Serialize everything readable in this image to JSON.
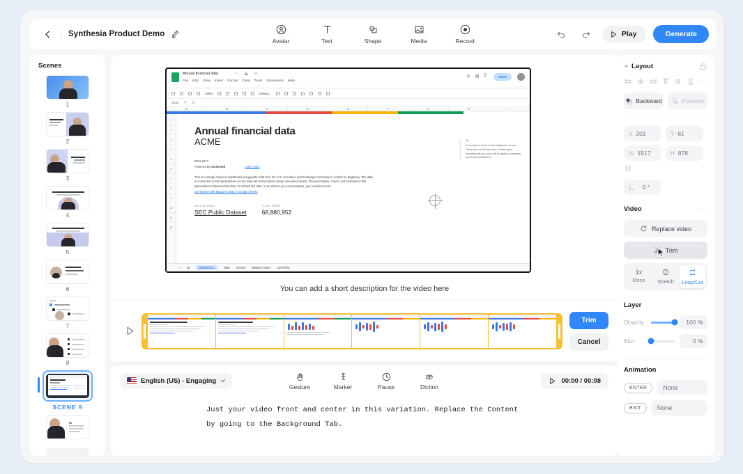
{
  "header": {
    "back_icon": "chevron-left-icon",
    "title": "Synthesia Product Demo",
    "edit_icon": "pencil-icon",
    "tools": [
      {
        "icon": "avatar-icon",
        "label": "Avatar"
      },
      {
        "icon": "text-icon",
        "label": "Text"
      },
      {
        "icon": "shape-icon",
        "label": "Shape"
      },
      {
        "icon": "media-icon",
        "label": "Media"
      },
      {
        "icon": "record-icon",
        "label": "Record"
      }
    ],
    "undo_icon": "undo-icon",
    "redo_icon": "redo-icon",
    "play_label": "Play",
    "generate_label": "Generate",
    "generate_color": "#2f87f8"
  },
  "scenes": {
    "title": "Scenes",
    "items": [
      {
        "number": "1",
        "selected": false
      },
      {
        "number": "2",
        "selected": false
      },
      {
        "number": "3",
        "selected": false
      },
      {
        "number": "4",
        "selected": false
      },
      {
        "number": "5",
        "selected": false
      },
      {
        "number": "6",
        "selected": false
      },
      {
        "number": "7",
        "selected": false
      },
      {
        "number": "8",
        "selected": false
      },
      {
        "number": "SCENE 9",
        "selected": true
      },
      {
        "number": "",
        "selected": false
      }
    ],
    "add_label": "+"
  },
  "canvas": {
    "caption": "You can add a short description for the video here",
    "sheet": {
      "doc_name": "Annual financial data",
      "menus": [
        "File",
        "Edit",
        "View",
        "Insert",
        "Format",
        "Data",
        "Tools",
        "Extensions",
        "Help"
      ],
      "zoom": "100%",
      "font": "Defaul...",
      "cell_ref": "Q1W",
      "share_label": "Share",
      "columns": [
        "A",
        "B",
        "C",
        "D",
        "E",
        "F",
        "G",
        "H",
        "I"
      ],
      "rows": [
        "1",
        "2",
        "3",
        "4",
        "5",
        "6",
        "7",
        "8",
        "9",
        "10",
        "11",
        "12"
      ],
      "title": "Annual financial data",
      "subtitle": "ACME",
      "years": "2013-2017",
      "powered_prefix": "Powered by ",
      "powered_bold": "connected",
      "learn_more": "Learn more",
      "paragraph": "This is a sample financial dashboard using public data from the U.S. Securities and Exchange Commission, hosted on BigQuery. The data is connected to this spreadsheet via the Data tab at the bottom using connected sheets. The pivot tables, charts, and functions in this spreadsheet reference that data. To refresh the data, or to perform your own analysis, you need access to",
      "bigquery_link": "Get started with BigQuery data in Google Sheets",
      "kpis": [
        {
          "label": "DATA SOURCE",
          "value": "SEC Public Dataset",
          "underline": true
        },
        {
          "label": "TOTAL ROWS",
          "value": "68,980,952",
          "underline": false
        }
      ],
      "tip_title": "Tip",
      "tip_body": "To change the theme for this dashboard, choose Theme from the Format menu. Theme styles including fonts and colors will be applied consistently across this spreadsheet",
      "tabs": [
        "Alphabet Inc.",
        "Data",
        "Income",
        "Balance sheet",
        "Cash flow"
      ],
      "active_tab": "Alphabet Inc."
    }
  },
  "trim": {
    "play_icon": "play-triangle-icon",
    "frame_count": 6,
    "handle_color": "#f7c033",
    "trim_label": "Trim",
    "cancel_label": "Cancel"
  },
  "script": {
    "language": "English (US) - Engaging",
    "language_flag": "us-flag-icon",
    "chevron": "chevron-down-icon",
    "tools": [
      {
        "icon": "gesture-hand-icon",
        "label": "Gesture"
      },
      {
        "icon": "marker-icon",
        "label": "Marker"
      },
      {
        "icon": "pause-clock-icon",
        "label": "Pause"
      },
      {
        "icon": "diction-icon",
        "label": "Diction"
      }
    ],
    "timer": "00:00 / 00:08",
    "text": "Just your video front and center in this variation. Replace the Content by going to the Background Tab."
  },
  "right_panel": {
    "layout": {
      "title": "Layout",
      "collapse_icon": "caret-down-icon",
      "lock_icon": "unlocked-padlock-icon",
      "align_icons": [
        "align-left-icon",
        "align-center-horizontal-icon",
        "align-right-icon",
        "align-top-icon",
        "align-middle-vertical-icon",
        "align-bottom-icon",
        "more-icon"
      ],
      "backward_label": "Backward",
      "forward_label": "Forward",
      "fields": [
        {
          "key": "X",
          "value": "201"
        },
        {
          "key": "Y",
          "value": "61"
        },
        {
          "key": "W",
          "value": "1517"
        },
        {
          "key": "H",
          "value": "878"
        }
      ],
      "rotation_label": "0 °",
      "link_icon": "link-aspect-ratio-icon"
    },
    "video": {
      "title": "Video",
      "more_icon": "more-dots-icon",
      "replace_label": "Replace video",
      "replace_icon": "refresh-icon",
      "trim_label": "Trim",
      "trim_icon": "scissors-icon",
      "modes": [
        {
          "icon": "1x",
          "label": "Once",
          "selected": false
        },
        {
          "icon": "stretch-icon",
          "label": "Stretch",
          "selected": false
        },
        {
          "icon": "loop-icon",
          "label": "Loop/Cut",
          "selected": true
        }
      ]
    },
    "layer": {
      "title": "Layer",
      "opacity_label": "Opacity",
      "opacity_value": "100",
      "opacity_unit": "%",
      "opacity_pct": 100,
      "blur_label": "Blur",
      "blur_value": "0",
      "blur_unit": "%",
      "blur_pct": 0
    },
    "animation": {
      "title": "Animation",
      "enter_tag": "ENTER",
      "enter_value": "None",
      "exit_tag": "EXIT",
      "exit_value": "None"
    }
  }
}
